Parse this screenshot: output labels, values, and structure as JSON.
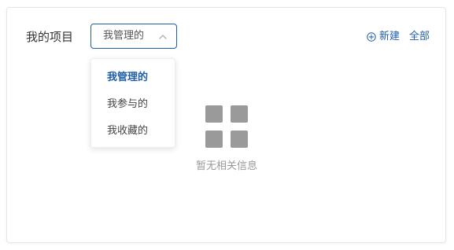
{
  "panel": {
    "title": "我的项目",
    "filter": {
      "selected": "我管理的",
      "options": [
        "我管理的",
        "我参与的",
        "我收藏的"
      ]
    },
    "actions": {
      "new_label": "新建",
      "all_label": "全部"
    },
    "empty_state": {
      "icon": "grid-icon",
      "text": "暂无相关信息"
    }
  },
  "colors": {
    "accent": "#1f5ea8",
    "text_primary": "#333333",
    "text_muted": "#999999",
    "placeholder_icon": "#9a9a9a"
  },
  "icons": {
    "select_arrow": "chevron-up-icon",
    "new": "plus-circle-icon",
    "empty": "grid-icon"
  }
}
